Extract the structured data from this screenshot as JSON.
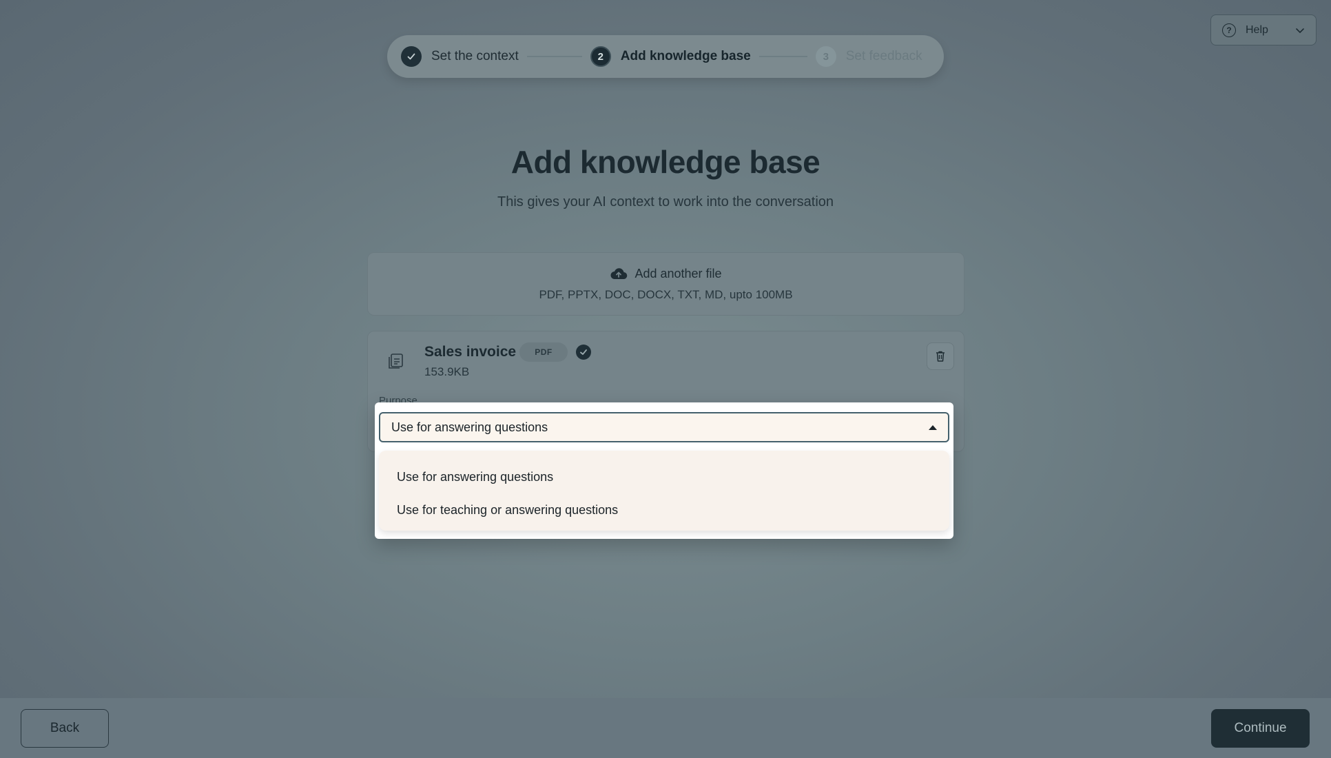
{
  "stepper": {
    "steps": [
      {
        "number": "",
        "label": "Set the context",
        "state": "done"
      },
      {
        "number": "2",
        "label": "Add knowledge base",
        "state": "active"
      },
      {
        "number": "3",
        "label": "Set feedback",
        "state": "todo"
      }
    ]
  },
  "help": {
    "label": "Help"
  },
  "header": {
    "title": "Add knowledge base",
    "subtitle": "This gives your AI context to work into the conversation"
  },
  "upload": {
    "label": "Add another file",
    "formats": "PDF, PPTX, DOC, DOCX, TXT, MD, upto 100MB"
  },
  "file": {
    "name": "Sales invoice",
    "type_badge": "PDF",
    "size": "153.9KB",
    "purpose_label": "Purpose",
    "purpose_value": "Use for answering questions",
    "purpose_options": [
      "Use for answering questions",
      "Use for teaching or answering questions"
    ]
  },
  "footer": {
    "back_label": "Back",
    "continue_label": "Continue"
  }
}
